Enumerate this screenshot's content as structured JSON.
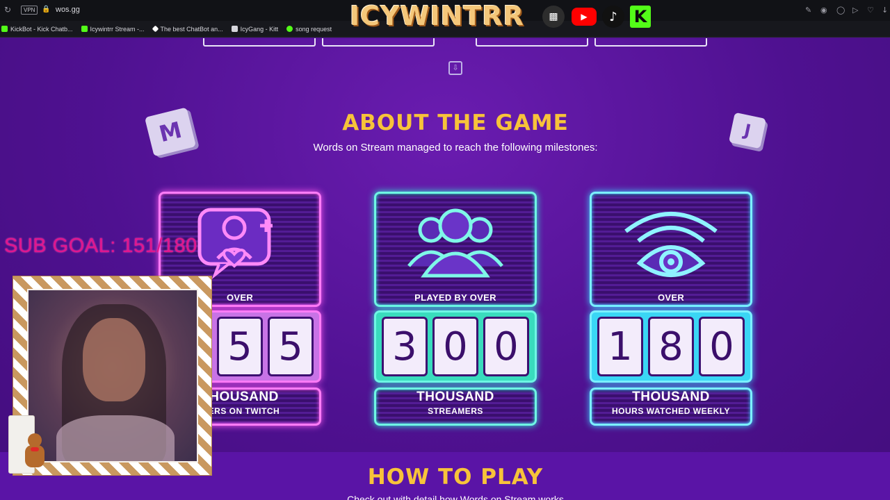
{
  "browser": {
    "vpn_label": "VPN",
    "url": "wos.gg",
    "bookmarks": [
      {
        "label": "KickBot - Kick Chatb...",
        "color": "#53fc18"
      },
      {
        "label": "Icywintrr Stream -...",
        "color": "#53fc18"
      },
      {
        "label": "The best ChatBot an...",
        "color": "#ffffff"
      },
      {
        "label": "IcyGang - Kitt",
        "color": "#d6d6dc"
      },
      {
        "label": "song request",
        "color": "#53fc18"
      }
    ]
  },
  "overlay": {
    "logo_text": "ICYWINTRR",
    "socials": {
      "twitch": "twitch-icon",
      "youtube": "youtube-icon",
      "tiktok": "tiktok-icon",
      "kick": "K"
    },
    "sub_goal": "SUB GOAL: 151/180"
  },
  "page": {
    "cube_left": "M",
    "cube_right": "J",
    "about_title": "ABOUT THE GAME",
    "about_subtitle": "Words on Stream managed to reach the following milestones:",
    "cards": [
      {
        "label": "OVER",
        "digits": [
          "5",
          "5"
        ],
        "unit": "THOUSAND",
        "desc": "WERS ON TWITCH",
        "icon": "user-heart-chat-icon",
        "color": "#ff7cf7"
      },
      {
        "label": "PLAYED BY OVER",
        "digits": [
          "3",
          "0",
          "0"
        ],
        "unit": "THOUSAND",
        "desc": "STREAMERS",
        "icon": "user-group-icon",
        "color": "#6ff6e4"
      },
      {
        "label": "OVER",
        "digits": [
          "1",
          "8",
          "0"
        ],
        "unit": "THOUSAND",
        "desc": "HOURS WATCHED WEEKLY",
        "icon": "eye-signal-icon",
        "color": "#7cf0ff"
      }
    ],
    "how_title": "HOW TO PLAY",
    "how_subtitle": "Check out with detail how Words on Stream works"
  }
}
